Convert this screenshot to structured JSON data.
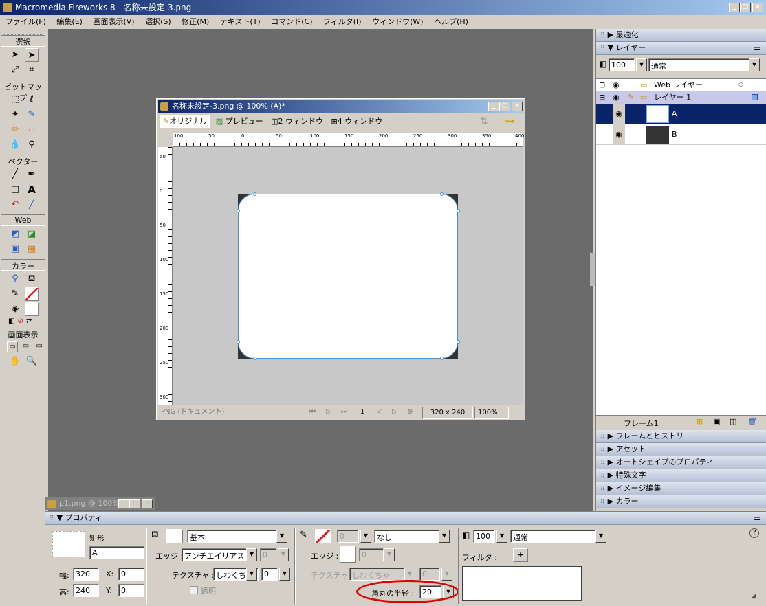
{
  "app": {
    "title": "Macromedia Fireworks 8 - 名称未設定-3.png"
  },
  "menu": [
    "ファイル(F)",
    "編集(E)",
    "画面表示(V)",
    "選択(S)",
    "修正(M)",
    "テキスト(T)",
    "コマンド(C)",
    "フィルタ(I)",
    "ウィンドウ(W)",
    "ヘルプ(H)"
  ],
  "tools": {
    "select": "選択",
    "bitmap": "ビットマップ",
    "vector": "ベクター",
    "web": "Web",
    "color": "カラー",
    "view": "画面表示"
  },
  "doc": {
    "title": "名称未設定-3.png @ 100% (A)*",
    "tabs": [
      "オリジナル",
      "プレビュー",
      "2 ウィンドウ",
      "4 ウィンドウ"
    ],
    "status": "PNG (ドキュメント)",
    "frame": "1",
    "size": "320 x 240",
    "zoom": "100%",
    "hticks": [
      "100",
      "50",
      "0",
      "50",
      "100",
      "150",
      "200",
      "250",
      "300",
      "350",
      "400"
    ],
    "vticks": [
      "50",
      "0",
      "50",
      "100",
      "150",
      "200",
      "250",
      "300"
    ]
  },
  "doc2": {
    "title": "p1.png @ 100%"
  },
  "panels": {
    "optimize": "最適化",
    "layers": "レイヤー",
    "opacity": "100",
    "blend": "通常",
    "web_layer": "Web レイヤー",
    "layer1": "レイヤー 1",
    "objA": "A",
    "objB": "B",
    "frame": "フレーム1",
    "collapsed": [
      "フレームとヒストリ",
      "アセット",
      "オートシェイプのプロパティ",
      "特殊文字",
      "イメージ編集",
      "カラー"
    ]
  },
  "props": {
    "title": "プロパティ",
    "type": "矩形",
    "name": "A",
    "w_label": "幅:",
    "w": "320",
    "h_label": "高:",
    "h": "240",
    "x_label": "X:",
    "x": "0",
    "y_label": "Y:",
    "y": "0",
    "fill_type": "基本",
    "edge_label": "エッジ :",
    "edge": "アンチエイリアス",
    "edge_val": "0",
    "texture_label": "テクスチャ :",
    "texture": "しわくちゃ",
    "texture_val": "0",
    "transparent": "透明",
    "stroke_size": "0",
    "stroke_type": "なし",
    "stroke_edge_label": "エッジ :",
    "stroke_edge_val": "0",
    "stroke_texture_label": "テクスチャ :",
    "stroke_texture": "しわくちゃ",
    "stroke_texture_val": "0",
    "radius_label": "角丸の半径 :",
    "radius": "20",
    "opacity": "100",
    "blend": "通常",
    "filter_label": "フィルタ :"
  }
}
